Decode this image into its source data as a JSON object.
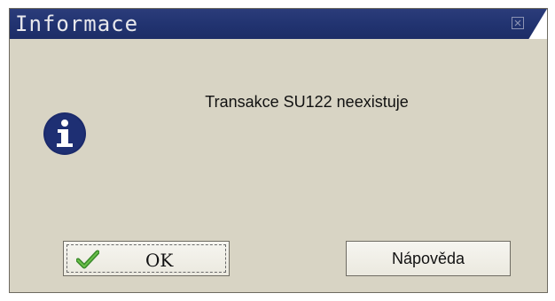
{
  "dialog": {
    "title": "Informace",
    "close_icon": "close-icon",
    "icon": "info-icon",
    "message": "Transakce SU122 neexistuje"
  },
  "buttons": {
    "ok": {
      "label": "OK",
      "icon": "checkmark-icon"
    },
    "help": {
      "label": "Nápověda"
    }
  },
  "colors": {
    "titlebar": "#213370",
    "background": "#d8d4c4",
    "info_icon": "#1b2a6b",
    "check_icon": "#3a8a2a"
  }
}
